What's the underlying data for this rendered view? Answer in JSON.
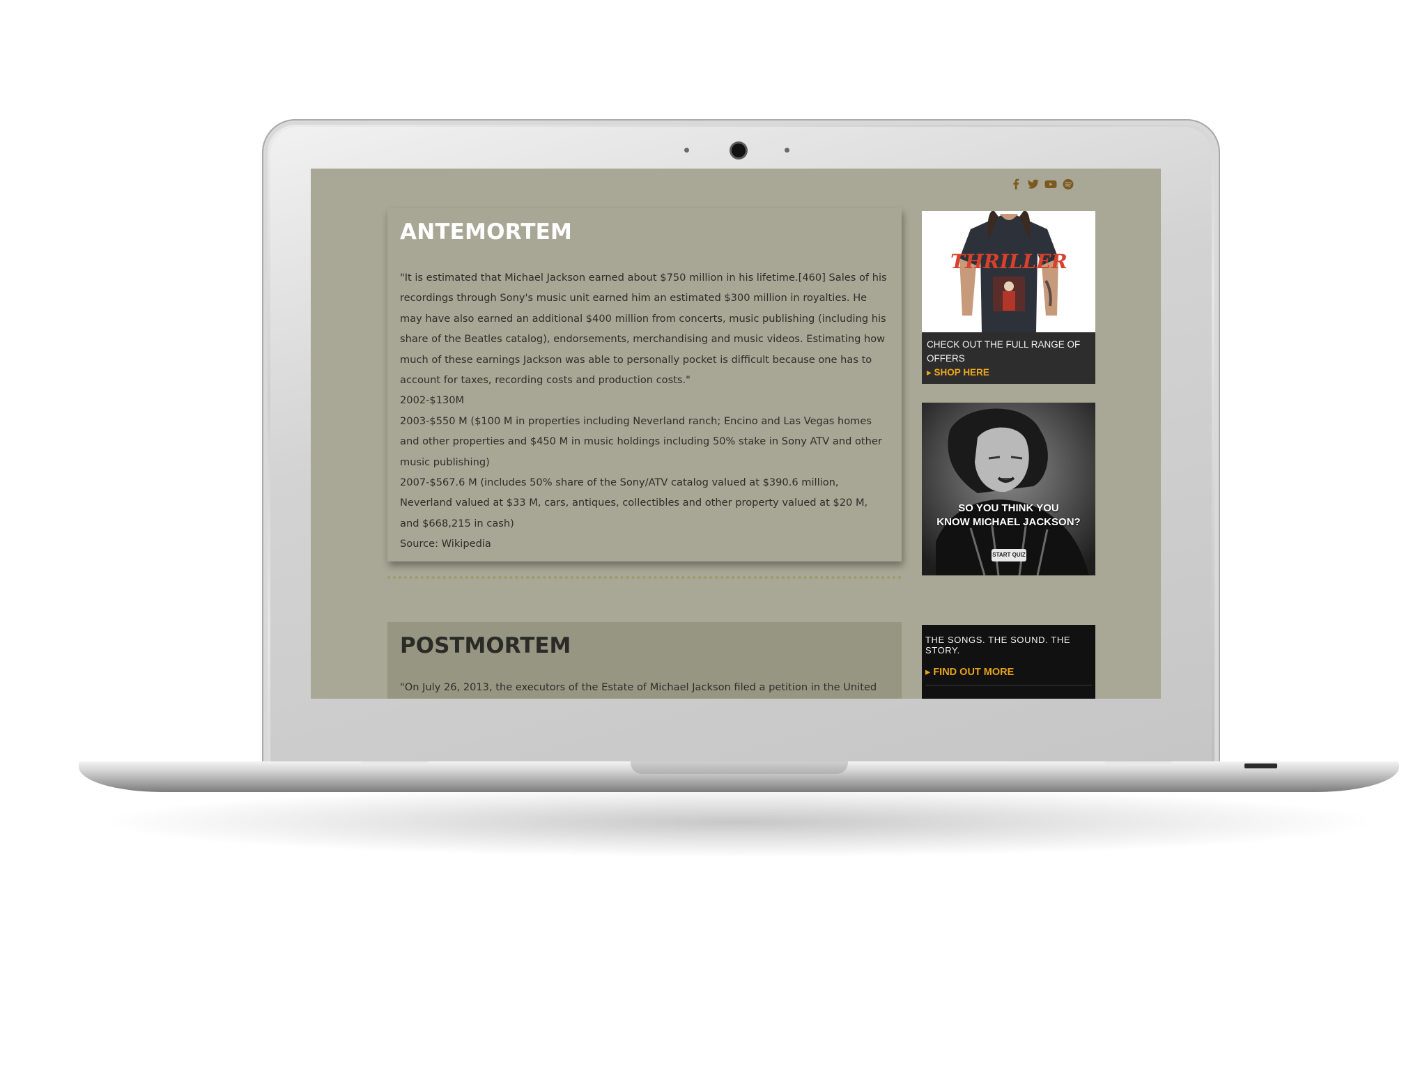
{
  "social": {
    "icons": [
      "facebook-icon",
      "twitter-icon",
      "youtube-icon",
      "spotify-icon"
    ],
    "color": "#7c5a1f"
  },
  "antemortem": {
    "title": "ANTEMORTEM",
    "paragraphs": [
      "\"It is estimated that Michael Jackson earned about $750 million in his lifetime.[460] Sales of his recordings through Sony's music unit earned him an estimated $300 million in royalties. He may have also earned an additional $400 million from concerts, music publishing (including his share of the Beatles catalog), endorsements, merchandising and music videos. Estimating how much of these earnings Jackson was able to personally pocket is difficult because one has to account for taxes, recording costs and production costs.\"",
      "2002-$130M",
      "2003-$550 M ($100 M in properties including Neverland ranch; Encino and Las Vegas homes and other properties and $450 M in music holdings including 50% stake in Sony ATV and other music publishing)",
      "2007-$567.6 M (includes 50% share of the Sony/ATV catalog valued at $390.6 million, Neverland valued at $33 M, cars, antiques, collectibles and other property valued at $20 M, and $668,215 in cash)",
      "Source: Wikipedia"
    ]
  },
  "postmortem": {
    "title": "POSTMORTEM",
    "intro": "\"On July 26, 2013, the executors of the Estate of Michael Jackson filed a petition in the United"
  },
  "ads": {
    "shirt": {
      "shirt_print": "THRILLER",
      "caption": "CHECK OUT THE FULL RANGE OF OFFERS",
      "cta": "SHOP HERE"
    },
    "quiz": {
      "question_line1": "SO YOU THINK YOU",
      "question_line2": "KNOW MICHAEL JACKSON?",
      "button": "START QUIZ"
    },
    "songs": {
      "tagline": "THE SONGS. THE SOUND. THE STORY.",
      "cta": "FIND OUT MORE"
    }
  },
  "colors": {
    "screen_bg": "#a9a795",
    "accent_orange": "#f0a81c"
  }
}
